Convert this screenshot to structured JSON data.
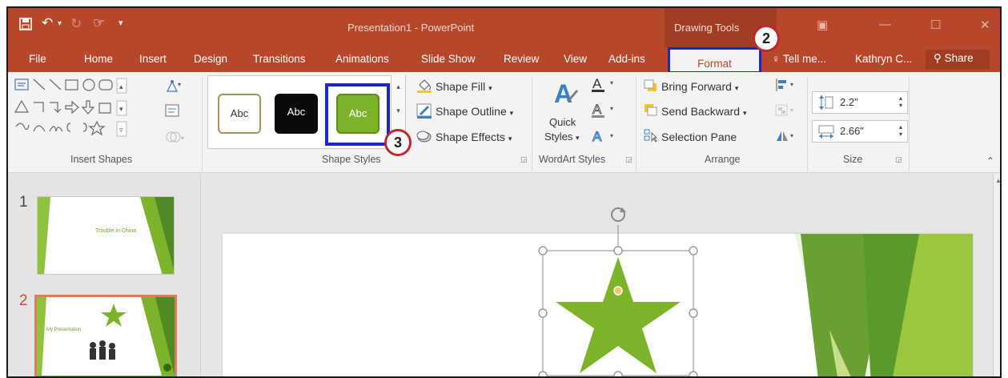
{
  "titlebar": {
    "doc_title": "Presentation1 - PowerPoint",
    "context": "Drawing Tools"
  },
  "tabs": {
    "file": "File",
    "home": "Home",
    "insert": "Insert",
    "design": "Design",
    "transitions": "Transitions",
    "animations": "Animations",
    "slideshow": "Slide Show",
    "review": "Review",
    "view": "View",
    "addins": "Add-ins",
    "format": "Format",
    "tellme": "Tell me...",
    "user": "Kathryn C...",
    "share": "Share"
  },
  "ribbon": {
    "insert_shapes": {
      "label": "Insert Shapes"
    },
    "shape_styles": {
      "label": "Shape Styles",
      "styles": [
        "Abc",
        "Abc",
        "Abc"
      ],
      "fill": "Shape Fill",
      "outline": "Shape Outline",
      "effects": "Shape Effects"
    },
    "wordart": {
      "label": "WordArt Styles",
      "quick_line1": "Quick",
      "quick_line2": "Styles"
    },
    "arrange": {
      "label": "Arrange",
      "bring_forward": "Bring Forward",
      "send_backward": "Send Backward",
      "selection_pane": "Selection Pane"
    },
    "size": {
      "label": "Size",
      "height": "2.2\"",
      "width": "2.66\""
    }
  },
  "callouts": {
    "format": "2",
    "style": "3"
  },
  "slides": [
    {
      "number": "1",
      "title": "Trouble in China"
    },
    {
      "number": "2",
      "title": "My Presentation"
    }
  ],
  "colors": {
    "accent": "#b7472a",
    "highlight": "#1d27c9",
    "star": "#7db32a"
  }
}
